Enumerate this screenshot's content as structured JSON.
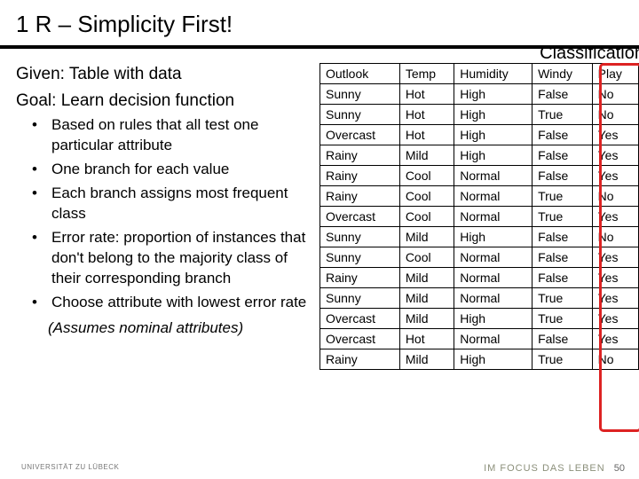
{
  "title": "1 R – Simplicity First!",
  "intro": {
    "line1": "Given: Table with data",
    "line2": "Goal: Learn decision function"
  },
  "bullets": [
    "Based on rules that all test one particular attribute",
    "One branch for each value",
    "Each branch assigns most frequent class",
    "Error rate: proportion of instances that don't belong to the majority class of their corresponding branch",
    "Choose attribute with lowest error rate"
  ],
  "assumes": "(Assumes nominal attributes)",
  "class_label": "Classification",
  "chart_data": {
    "type": "table",
    "columns": [
      "Outlook",
      "Temp",
      "Humidity",
      "Windy",
      "Play"
    ],
    "rows": [
      [
        "Sunny",
        "Hot",
        "High",
        "False",
        "No"
      ],
      [
        "Sunny",
        "Hot",
        "High",
        "True",
        "No"
      ],
      [
        "Overcast",
        "Hot",
        "High",
        "False",
        "Yes"
      ],
      [
        "Rainy",
        "Mild",
        "High",
        "False",
        "Yes"
      ],
      [
        "Rainy",
        "Cool",
        "Normal",
        "False",
        "Yes"
      ],
      [
        "Rainy",
        "Cool",
        "Normal",
        "True",
        "No"
      ],
      [
        "Overcast",
        "Cool",
        "Normal",
        "True",
        "Yes"
      ],
      [
        "Sunny",
        "Mild",
        "High",
        "False",
        "No"
      ],
      [
        "Sunny",
        "Cool",
        "Normal",
        "False",
        "Yes"
      ],
      [
        "Rainy",
        "Mild",
        "Normal",
        "False",
        "Yes"
      ],
      [
        "Sunny",
        "Mild",
        "Normal",
        "True",
        "Yes"
      ],
      [
        "Overcast",
        "Mild",
        "High",
        "True",
        "Yes"
      ],
      [
        "Overcast",
        "Hot",
        "Normal",
        "False",
        "Yes"
      ],
      [
        "Rainy",
        "Mild",
        "High",
        "True",
        "No"
      ]
    ],
    "highlight_column": "Play"
  },
  "footer": {
    "text": "IM FOCUS DAS LEBEN",
    "page": "50",
    "university": "UNIVERSITÄT ZU LÜBECK"
  }
}
